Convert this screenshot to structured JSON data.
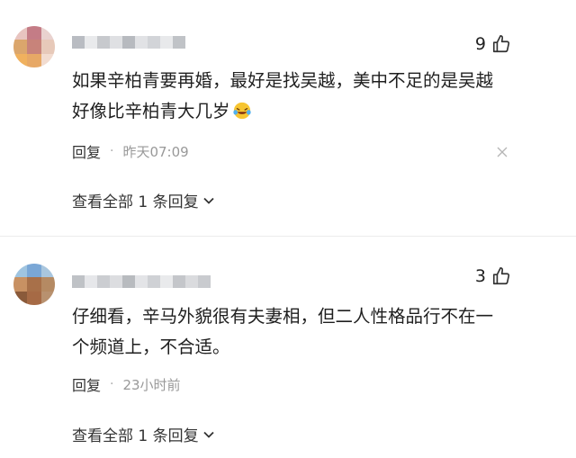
{
  "comments": [
    {
      "likes": "9",
      "text_line1": "如果辛柏青要再婚，最好是找吴越，美中不足的是吴越",
      "text_line2": "好像比辛柏青大几岁",
      "reply_label": "回复",
      "time": "昨天07:09",
      "view_replies": "查看全部 1 条回复",
      "has_emoji": true
    },
    {
      "likes": "3",
      "text_line1": "仔细看，辛马外貌很有夫妻相，但二人性格品行不在一",
      "text_line2": "个频道上，不合适。",
      "reply_label": "回复",
      "time": "23小时前",
      "view_replies": "查看全部 1 条回复",
      "has_emoji": false
    }
  ],
  "icons": {
    "like": "thumbs-up-icon",
    "close": "close-icon",
    "chevron": "chevron-down-icon",
    "emoji": "laughing-crying-emoji"
  },
  "colors": {
    "text": "#1f1f1f",
    "muted": "#999999",
    "divider": "#ececec"
  }
}
